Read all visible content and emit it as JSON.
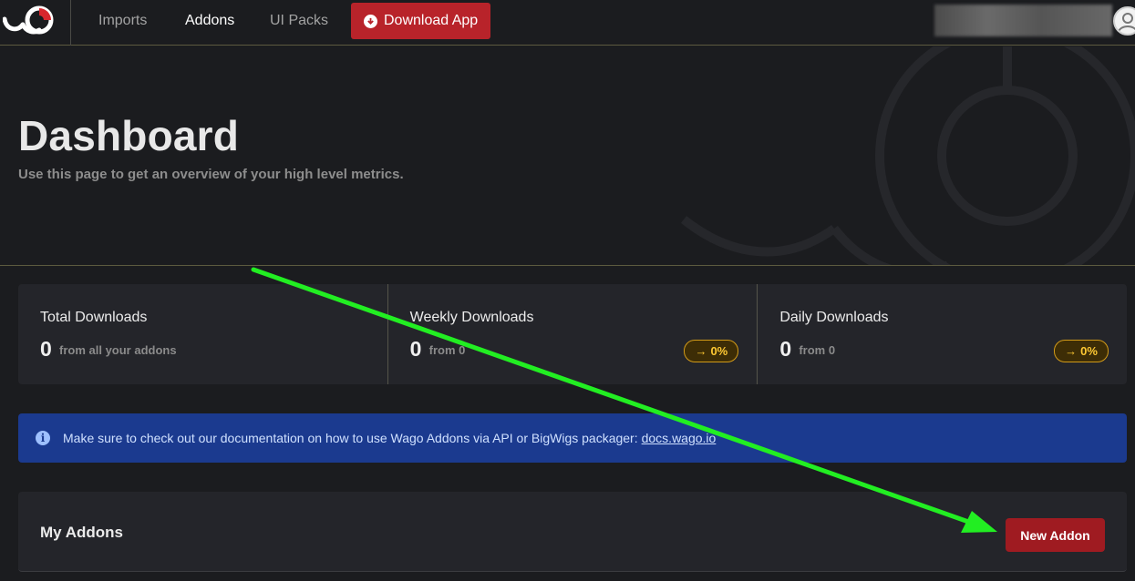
{
  "nav": {
    "links": [
      {
        "label": "Imports",
        "active": false
      },
      {
        "label": "Addons",
        "active": true
      },
      {
        "label": "UI Packs",
        "active": false
      }
    ],
    "download_label": "Download App"
  },
  "hero": {
    "title": "Dashboard",
    "subtitle": "Use this page to get an overview of your high level metrics."
  },
  "stats": [
    {
      "label": "Total Downloads",
      "value": "0",
      "from": "from all your addons",
      "badge": ""
    },
    {
      "label": "Weekly Downloads",
      "value": "0",
      "from": "from 0",
      "badge": "0%"
    },
    {
      "label": "Daily Downloads",
      "value": "0",
      "from": "from 0",
      "badge": "0%"
    }
  ],
  "alert": {
    "text": "Make sure to check out our documentation on how to use Wago Addons via API or BigWigs packager:",
    "link": "docs.wago.io"
  },
  "addons": {
    "title": "My Addons",
    "new_label": "New Addon"
  },
  "colors": {
    "accent_red": "#b8232a",
    "alert_blue": "#1b3a8f",
    "badge_orange": "#ffc933",
    "annotation_green": "#22ee22"
  }
}
